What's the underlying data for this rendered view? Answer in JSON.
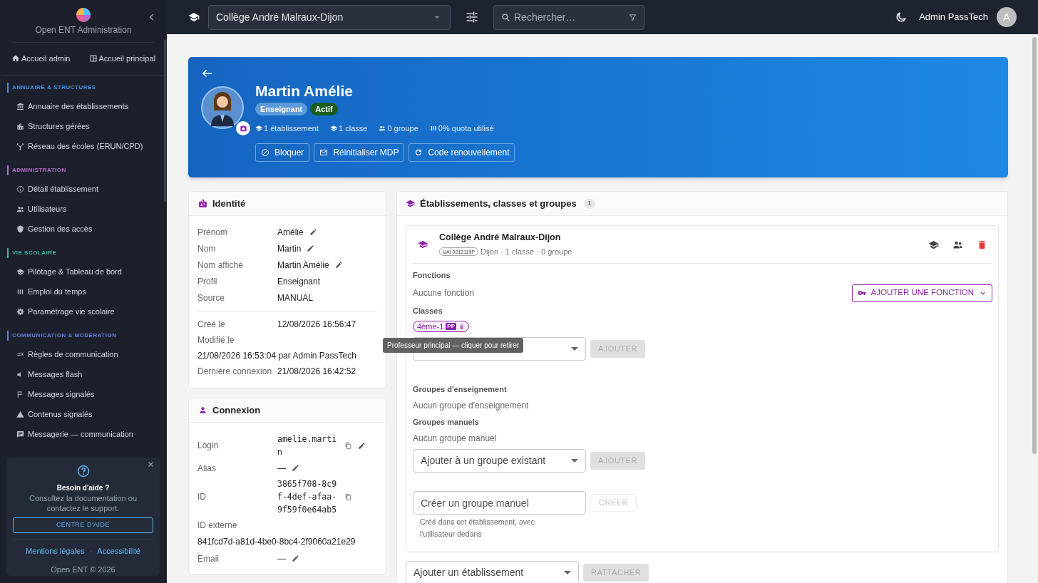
{
  "sidebar": {
    "app_title": "Open ENT Administration",
    "quick_links": [
      {
        "label": "Accueil admin"
      },
      {
        "label": "Accueil principal"
      }
    ],
    "sections": [
      {
        "title": "ANNUAIRE & STRUCTURES",
        "color": "#4a90e2",
        "items": [
          {
            "label": "Annuaire des établissements"
          },
          {
            "label": "Structures gérées"
          },
          {
            "label": "Réseau des écoles (ERUN/CPD)"
          }
        ]
      },
      {
        "title": "ADMINISTRATION",
        "color": "#b86cc8",
        "items": [
          {
            "label": "Détail établissement"
          },
          {
            "label": "Utilisateurs"
          },
          {
            "label": "Gestion des accès"
          }
        ]
      },
      {
        "title": "VIE SCOLAIRE",
        "color": "#3fb6a8",
        "items": [
          {
            "label": "Pilotage & Tableau de bord"
          },
          {
            "label": "Emploi du temps"
          },
          {
            "label": "Paramétrage vie scolaire"
          }
        ]
      },
      {
        "title": "COMMUNICATION & MODÉRATION",
        "color": "#6b7fe0",
        "items": [
          {
            "label": "Règles de communication"
          },
          {
            "label": "Messages flash"
          },
          {
            "label": "Messages signalés"
          },
          {
            "label": "Contenus signalés"
          },
          {
            "label": "Messagerie — communication"
          }
        ]
      }
    ],
    "help": {
      "title": "Besoin d'aide ?",
      "text": "Consultez la documentation ou contactez le support.",
      "button": "CENTRE D'AIDE",
      "links": [
        "Mentions légales",
        "Accessibilité"
      ],
      "separator": "·",
      "footer": "Open ENT © 2026"
    }
  },
  "topbar": {
    "school": "Collège André Malraux-Dijon",
    "search_placeholder": "Rechercher…",
    "user": "Admin PassTech",
    "avatar": "A"
  },
  "profile": {
    "name": "Martin Amélie",
    "badges": [
      {
        "label": "Enseignant",
        "color": "#5b9bd8"
      },
      {
        "label": "Actif",
        "color": "#1b5e20"
      }
    ],
    "stats": [
      "1 établissement",
      "1 classe",
      "0 groupe",
      "0% quota utilisé"
    ],
    "actions": [
      "Bloquer",
      "Réinitialiser MDP",
      "Code renouvellement"
    ]
  },
  "identity": {
    "title": "Identité",
    "fields": [
      {
        "label": "Prénom",
        "value": "Amélie",
        "editable": true
      },
      {
        "label": "Nom",
        "value": "Martin",
        "editable": true
      },
      {
        "label": "Nom affiché",
        "value": "Martin Amélie",
        "editable": true
      },
      {
        "label": "Profil",
        "value": "Enseignant",
        "editable": false
      },
      {
        "label": "Source",
        "value": "MANUAL",
        "editable": false
      }
    ],
    "dates": [
      {
        "label": "Créé le",
        "value": "12/08/2026 16:56:47",
        "kind": "inline"
      },
      {
        "label": "Modifié le",
        "value": "21/08/2026 16:53:04 par Admin PassTech",
        "kind": "wide"
      },
      {
        "label": "Dernière connexion",
        "value": "21/08/2026 16:42:52",
        "kind": "inline"
      }
    ]
  },
  "connexion": {
    "title": "Connexion",
    "fields": [
      {
        "label": "Login",
        "value": "amelie.martin",
        "kind": "inline",
        "mono": true,
        "copyable": true,
        "editable": true
      },
      {
        "label": "Alias",
        "value": "—",
        "kind": "inline",
        "mono": false,
        "copyable": false,
        "editable": true
      },
      {
        "label": "ID",
        "value": "3865f708-8c9f-4def-afaa-9f59f0e64ab5",
        "kind": "inline",
        "mono": true,
        "copyable": true,
        "editable": false
      },
      {
        "label": "ID externe",
        "value": "841fcd7d-a81d-4be0-8bc4-2f9060a21e29",
        "kind": "wide",
        "mono": false,
        "copyable": false,
        "editable": false
      },
      {
        "label": "Email",
        "value": "—",
        "kind": "inline",
        "mono": false,
        "copyable": false,
        "editable": true
      }
    ]
  },
  "establishments": {
    "title": "Établissements, classes et groupes",
    "count": "1",
    "items": [
      {
        "name": "Collège André Malraux-Dijon",
        "uai": "UAI 0212119P",
        "meta": "Dijon · 1 classe · 0 groupe",
        "functions_label": "Fonctions",
        "functions_empty": "Aucune fonction",
        "add_function": "AJOUTER UNE FONCTION",
        "classes_label": "Classes",
        "classes": [
          {
            "label": "4ème-1",
            "badge": "PP"
          }
        ],
        "class_add": {
          "button": "AJOUTER",
          "disabled": true
        },
        "tooltip": "Professeur principal — cliquer pour retirer",
        "teaching_label": "Groupes d'enseignement",
        "teaching_empty": "Aucun groupe d'enseignement",
        "manual_label": "Groupes manuels",
        "manual_empty": "Aucun groupe manuel",
        "group_add": {
          "placeholder": "Ajouter à un groupe existant",
          "button": "AJOUTER",
          "disabled": true
        },
        "group_create": {
          "placeholder": "Créer un groupe manuel",
          "button": "CREER",
          "disabled": true,
          "hint": "Créé dans cet établissement, avec l'utilisateur dedans"
        }
      }
    ],
    "attach": {
      "placeholder": "Ajouter un établissement",
      "button": "RATTACHER",
      "disabled": true
    }
  }
}
